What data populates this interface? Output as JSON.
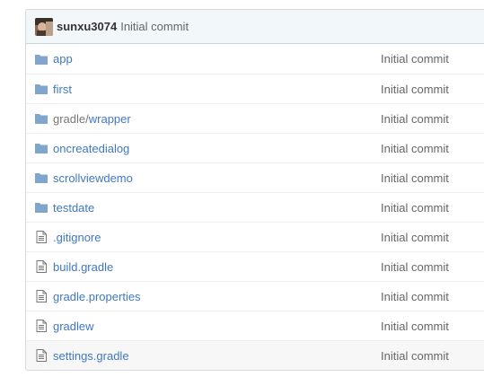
{
  "commit_tease": {
    "author": "sunxu3074",
    "message": "Initial commit"
  },
  "files": [
    {
      "icon": "folder-icon",
      "prefix": "",
      "name": "app",
      "message": "Initial commit"
    },
    {
      "icon": "folder-icon",
      "prefix": "",
      "name": "first",
      "message": "Initial commit"
    },
    {
      "icon": "folder-icon",
      "prefix": "gradle/",
      "name": "wrapper",
      "message": "Initial commit"
    },
    {
      "icon": "folder-icon",
      "prefix": "",
      "name": "oncreatedialog",
      "message": "Initial commit"
    },
    {
      "icon": "folder-icon",
      "prefix": "",
      "name": "scrollviewdemo",
      "message": "Initial commit"
    },
    {
      "icon": "folder-icon",
      "prefix": "",
      "name": "testdate",
      "message": "Initial commit"
    },
    {
      "icon": "file-icon",
      "prefix": "",
      "name": ".gitignore",
      "message": "Initial commit"
    },
    {
      "icon": "file-icon",
      "prefix": "",
      "name": "build.gradle",
      "message": "Initial commit"
    },
    {
      "icon": "file-icon",
      "prefix": "",
      "name": "gradle.properties",
      "message": "Initial commit"
    },
    {
      "icon": "file-icon",
      "prefix": "",
      "name": "gradlew",
      "message": "Initial commit"
    },
    {
      "icon": "file-icon",
      "prefix": "",
      "name": "settings.gradle",
      "message": "Initial commit"
    }
  ],
  "colors": {
    "link": "#4078c0",
    "folder": "#80a6cd",
    "file_icon": "#777777",
    "header_bg": "#f2f8fa"
  }
}
